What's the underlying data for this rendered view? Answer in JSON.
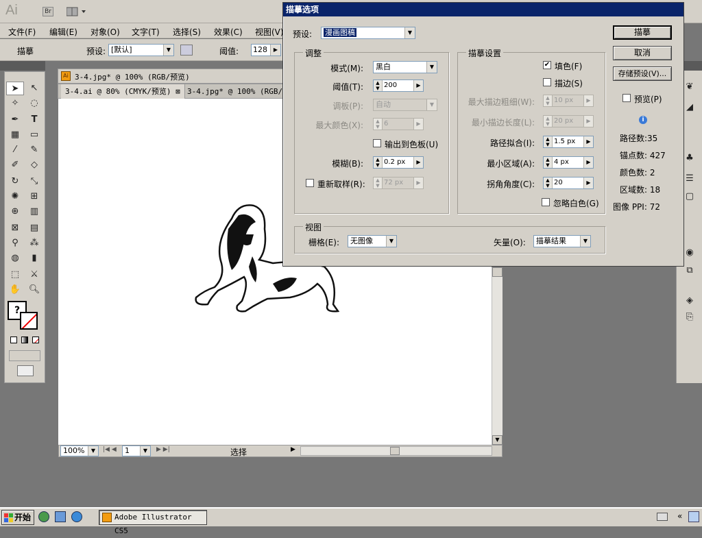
{
  "appbar": {
    "logo": "Ai",
    "br": "Br"
  },
  "menubar": [
    "文件(F)",
    "编辑(E)",
    "对象(O)",
    "文字(T)",
    "选择(S)",
    "效果(C)",
    "视图(V)"
  ],
  "controlbar": {
    "mode": "描摹",
    "preset_label": "预设:",
    "preset_value": "[默认]",
    "threshold_label": "阈值:",
    "threshold_value": "128"
  },
  "document": {
    "title": "3-4.jpg* @ 100% (RGB/预览)",
    "tabs": [
      {
        "label": "3-4.ai @ 80% (CMYK/预览)"
      },
      {
        "label": "3-4.jpg* @ 100% (RGB/预"
      }
    ],
    "zoom": "100%",
    "page": "1",
    "status": "选择"
  },
  "dialog": {
    "title": "描摹选项",
    "preset_label": "预设:",
    "preset_value": "漫画图稿",
    "adjust": {
      "legend": "调整",
      "mode_label": "模式(M):",
      "mode_value": "黑白",
      "threshold_label": "阈值(T):",
      "threshold_value": "200",
      "palette_label": "调板(P):",
      "palette_value": "自动",
      "maxcolors_label": "最大颜色(X):",
      "maxcolors_value": "6",
      "output_swatches_label": "输出到色板(U)",
      "blur_label": "模糊(B):",
      "blur_value": "0.2 px",
      "resample_label": "重新取样(R):",
      "resample_value": "72 px"
    },
    "trace": {
      "legend": "描摹设置",
      "fill_label": "填色(F)",
      "fill_checked": true,
      "stroke_label": "描边(S)",
      "stroke_checked": false,
      "maxstroke_label": "最大描边粗细(W):",
      "maxstroke_value": "10 px",
      "minstroke_label": "最小描边长度(L):",
      "minstroke_value": "20 px",
      "pathfit_label": "路径拟合(I):",
      "pathfit_value": "1.5 px",
      "minarea_label": "最小区域(A):",
      "minarea_value": "4 px",
      "corner_label": "拐角角度(C):",
      "corner_value": "20",
      "ignore_white_label": "忽略白色(G)"
    },
    "view": {
      "legend": "视图",
      "raster_label": "栅格(E):",
      "raster_value": "无图像",
      "vector_label": "矢量(O):",
      "vector_value": "描摹结果"
    },
    "buttons": {
      "trace": "描摹",
      "cancel": "取消",
      "save_preset": "存储预设(V)..."
    },
    "preview_label": "预览(P)",
    "stats": {
      "paths": "路径数:35",
      "anchors": "锚点数: 427",
      "colors": "颜色数: 2",
      "areas": "区域数: 18",
      "ppi": "图像 PPI: 72"
    }
  },
  "taskbar": {
    "start": "开始",
    "app": "Adobe Illustrator CS5"
  }
}
